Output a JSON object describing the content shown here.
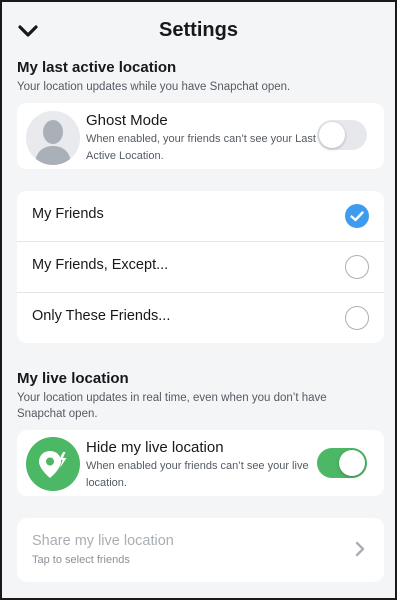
{
  "header": {
    "title": "Settings",
    "back_icon": "chevron-down-icon"
  },
  "last_active": {
    "heading": "My last active location",
    "subtitle": "Your location updates while you have Snapchat open.",
    "ghost_mode": {
      "title": "Ghost Mode",
      "description": "When enabled, your friends can’t see your Last Active Location.",
      "enabled": false,
      "avatar_icon": "default-avatar-icon"
    },
    "options": [
      {
        "label": "My Friends",
        "selected": true
      },
      {
        "label": "My Friends, Except...",
        "selected": false
      },
      {
        "label": "Only These Friends...",
        "selected": false
      }
    ]
  },
  "live_location": {
    "heading": "My live location",
    "subtitle": "Your location updates in real time, even when you don’t have Snapchat open.",
    "hide": {
      "title": "Hide my live location",
      "description": "When enabled your friends can’t see your live location.",
      "enabled": true,
      "icon": "live-location-icon"
    },
    "share": {
      "title": "Share my live location",
      "subtitle": "Tap to select friends",
      "icon": "chevron-right-icon"
    }
  },
  "colors": {
    "background": "#f4f5f7",
    "card": "#ffffff",
    "toggle_on": "#4cb764",
    "toggle_off": "#e6e8ec",
    "radio_checked": "#3d9cf0",
    "text_primary": "#16191c",
    "text_secondary": "#545b63",
    "text_disabled": "#a9aeb4"
  }
}
